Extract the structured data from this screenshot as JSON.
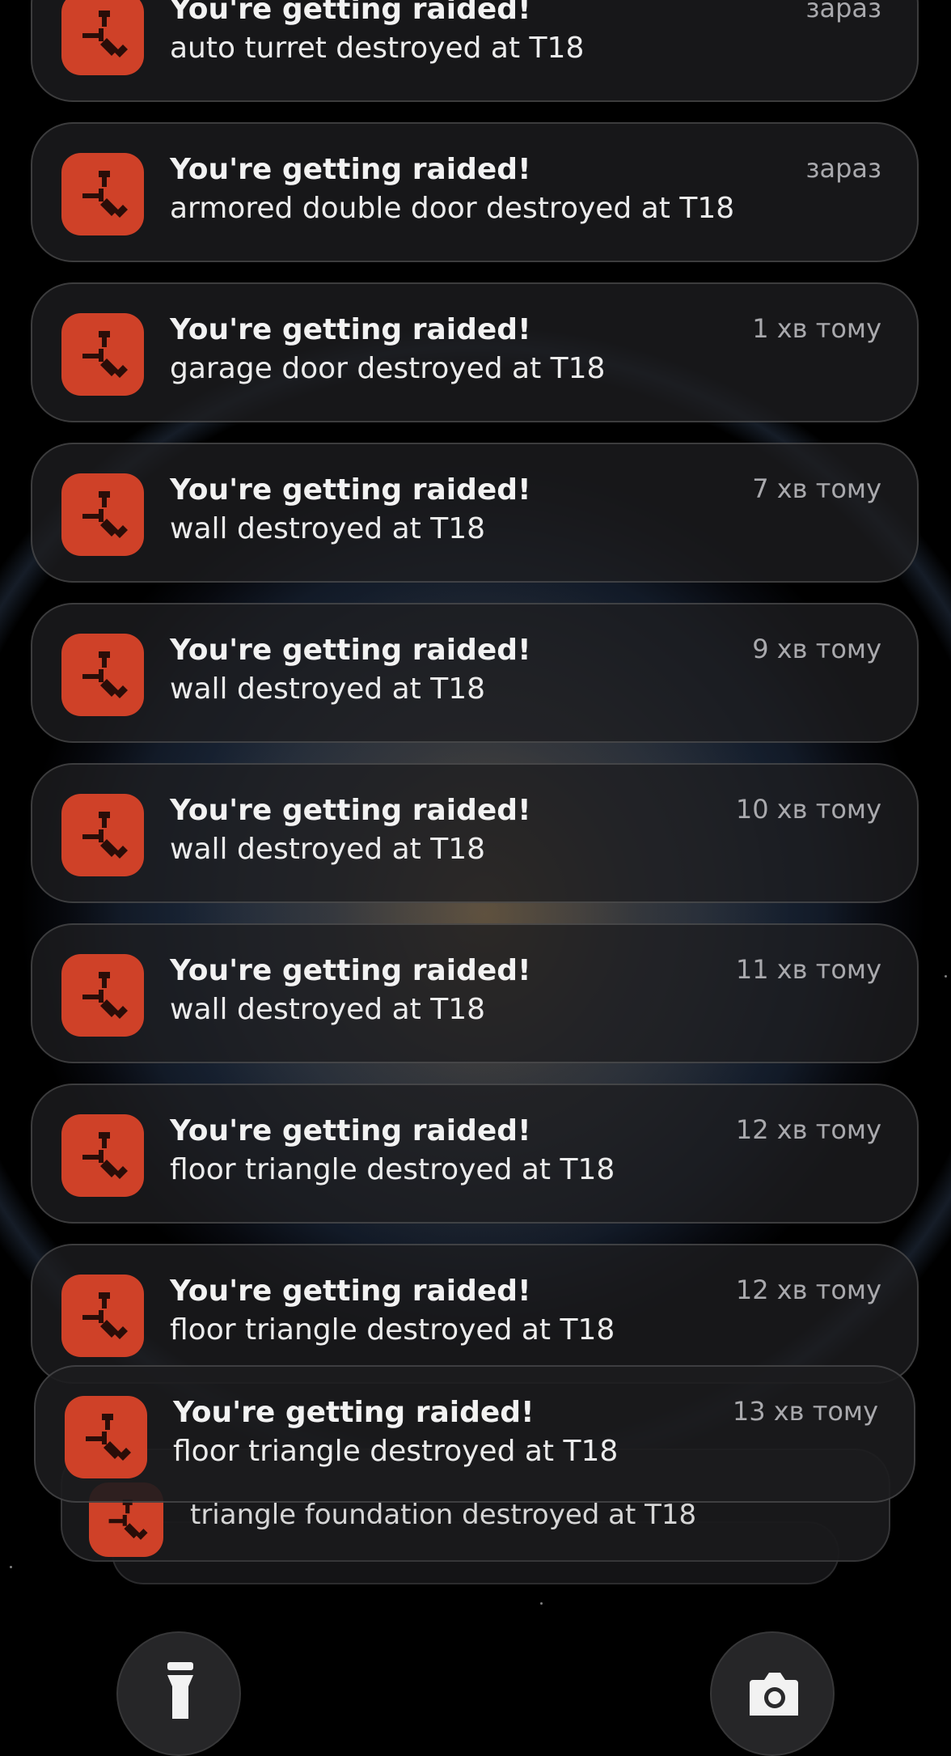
{
  "app": {
    "icon": "rust-app-icon",
    "accent_color": "#cf4128"
  },
  "notifications": [
    {
      "title": "You're getting raided!",
      "body": "auto turret destroyed at T18",
      "time": "зараз"
    },
    {
      "title": "You're getting raided!",
      "body": "armored double door destroyed at T18",
      "time": "зараз"
    },
    {
      "title": "You're getting raided!",
      "body": "garage door destroyed at T18",
      "time": "1 хв тому"
    },
    {
      "title": "You're getting raided!",
      "body": "wall destroyed at T18",
      "time": "7 хв тому"
    },
    {
      "title": "You're getting raided!",
      "body": "wall destroyed at T18",
      "time": "9 хв тому"
    },
    {
      "title": "You're getting raided!",
      "body": "wall destroyed at T18",
      "time": "10 хв тому"
    },
    {
      "title": "You're getting raided!",
      "body": "wall destroyed at T18",
      "time": "11 хв тому"
    },
    {
      "title": "You're getting raided!",
      "body": "floor triangle destroyed at T18",
      "time": "12 хв тому"
    },
    {
      "title": "You're getting raided!",
      "body": "floor triangle destroyed at T18",
      "time": "12 хв тому"
    },
    {
      "title": "You're getting raided!",
      "body": "floor triangle destroyed at T18",
      "time": "13 хв тому"
    }
  ],
  "stack_peek": {
    "body": "triangle foundation destroyed at T18"
  },
  "lockscreen_shortcuts": {
    "left_icon": "flashlight-icon",
    "right_icon": "camera-icon"
  }
}
